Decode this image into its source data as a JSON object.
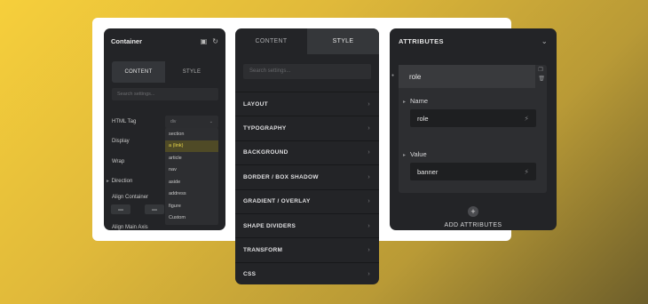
{
  "container_panel": {
    "title": "Container",
    "tabs": [
      "CONTENT",
      "STYLE"
    ],
    "search_placeholder": "Search settings...",
    "rows": [
      "HTML Tag",
      "Display",
      "Wrap",
      "Direction",
      "Align Container",
      "Align Main Axis"
    ],
    "html_tag_value": "div",
    "dropdown_options": [
      "section",
      "a (link)",
      "article",
      "nav",
      "aside",
      "address",
      "figure",
      "Custom"
    ],
    "selected_option": "a (link)"
  },
  "style_panel": {
    "tabs": [
      "CONTENT",
      "STYLE"
    ],
    "search_placeholder": "Search settings...",
    "sections": [
      "LAYOUT",
      "TYPOGRAPHY",
      "BACKGROUND",
      "BORDER / BOX SHADOW",
      "GRADIENT / OVERLAY",
      "SHAPE DIVIDERS",
      "TRANSFORM",
      "CSS"
    ]
  },
  "attributes_panel": {
    "title": "ATTRIBUTES",
    "attribute_label": "role",
    "name_label": "Name",
    "name_value": "role",
    "value_label": "Value",
    "value_value": "banner",
    "add_label": "ADD ATTRIBUTES"
  },
  "colors": {
    "accent_highlight": "#e8d54a",
    "panel_bg": "#232427"
  }
}
